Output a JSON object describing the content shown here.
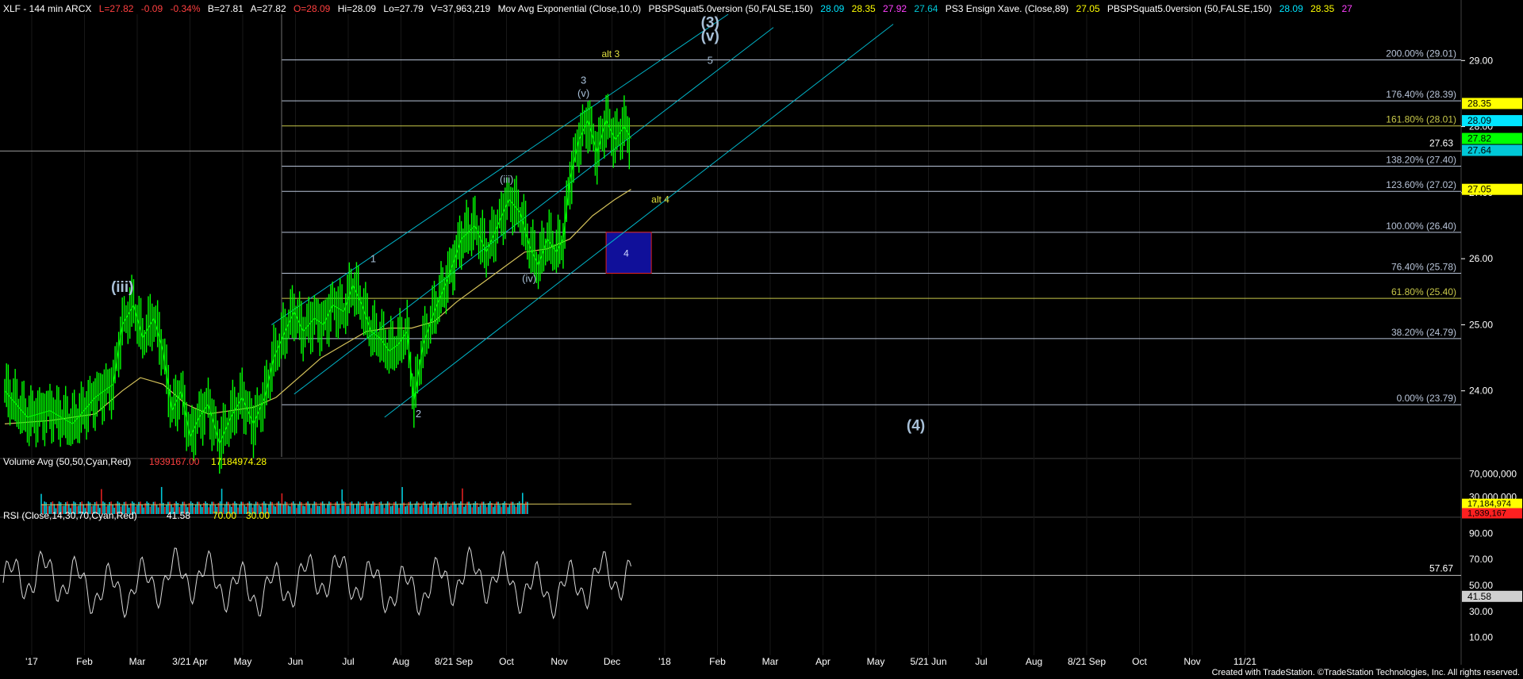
{
  "header": {
    "symbol": "XLF - 144 min ARCX",
    "last": "L=27.82",
    "chg": "-0.09",
    "pct": "-0.34%",
    "bid": "B=27.81",
    "ask": "A=27.82",
    "open": "O=28.09",
    "hi": "Hi=28.09",
    "lo": "Lo=27.79",
    "vol": "V=37,963,219",
    "ema_label": "Mov Avg Exponential (Close,10,0)",
    "ind1_label": "PBSPSquat5.0version (50,FALSE,150)",
    "ind1_vals": [
      "28.09",
      "28.35",
      "27.92",
      "27.64"
    ],
    "ind2_label": "PS3 Ensign Xave. (Close,89)",
    "ind2_val": "27.05",
    "ind3_label": "PBSPSquat5.0version (50,FALSE,150)",
    "ind3_vals": [
      "28.09",
      "28.35",
      "27"
    ]
  },
  "volume_panel": {
    "label": "Volume Avg (50,50,Cyan,Red)",
    "val1": "1939167.00",
    "val2": "17184974.28",
    "ticks": [
      "70,000,000",
      "30,000,000"
    ],
    "badge_avg": "17,184,974",
    "badge_last": "1,939,167"
  },
  "rsi_panel": {
    "label": "RSI (Close,14,30,70,Cyan,Red)",
    "val": "41.58",
    "ob": "70.00",
    "os": "30.00",
    "ticks": [
      "90.00",
      "70.00",
      "50.00",
      "30.00",
      "10.00"
    ],
    "level_label": "57.67",
    "badge": "41.58"
  },
  "footer": "Created with TradeStation. ©TradeStation Technologies, Inc. All rights reserved.",
  "colors": {
    "price": "#00ff00",
    "ema": "#d4c25a",
    "channel": "#00b4c8",
    "fib": "#b8c4d8",
    "fib_gold": "#c8c84a",
    "label_blue": "#a8c0d8",
    "label_gold": "#e0e040",
    "box": "#10109a"
  },
  "chart_data": {
    "type": "line",
    "title": "XLF - 144 min ARCX",
    "ylim": [
      23.0,
      29.7
    ],
    "y_ticks": [
      "29.00",
      "28.00",
      "27.00",
      "26.00",
      "25.00",
      "24.00"
    ],
    "x_labels": [
      "'17",
      "Feb",
      "Mar",
      "3/21 Apr",
      "May",
      "Jun",
      "Jul",
      "Aug",
      "8/21 Sep",
      "Oct",
      "Nov",
      "Dec",
      "'18",
      "Feb",
      "Mar",
      "Apr",
      "May",
      "5/21 Jun",
      "Jul",
      "Aug",
      "8/21 Sep",
      "Oct",
      "Nov",
      "11/21"
    ],
    "series": [
      {
        "values": [
          [
            0,
            24.0
          ],
          [
            10,
            23.6
          ],
          [
            20,
            23.7
          ],
          [
            30,
            23.5
          ],
          [
            40,
            23.9
          ],
          [
            48,
            24.1
          ],
          [
            52,
            25.0
          ],
          [
            57,
            25.3
          ],
          [
            61,
            24.8
          ],
          [
            66,
            25.1
          ],
          [
            70,
            24.6
          ],
          [
            74,
            23.7
          ],
          [
            78,
            24.0
          ],
          [
            82,
            23.3
          ],
          [
            86,
            23.6
          ],
          [
            90,
            23.8
          ],
          [
            95,
            23.2
          ],
          [
            100,
            23.6
          ],
          [
            105,
            23.9
          ],
          [
            110,
            23.5
          ],
          [
            115,
            23.9
          ],
          [
            119,
            24.5
          ],
          [
            124,
            24.9
          ],
          [
            128,
            25.2
          ],
          [
            132,
            24.9
          ],
          [
            137,
            25.1
          ],
          [
            141,
            25.0
          ],
          [
            145,
            25.3
          ],
          [
            150,
            25.2
          ],
          [
            154,
            25.6
          ],
          [
            158,
            25.3
          ],
          [
            162,
            24.9
          ],
          [
            166,
            24.8
          ],
          [
            170,
            24.6
          ],
          [
            174,
            24.7
          ],
          [
            178,
            24.9
          ],
          [
            181,
            23.85
          ],
          [
            185,
            24.7
          ],
          [
            190,
            25.2
          ],
          [
            196,
            25.7
          ],
          [
            202,
            26.3
          ],
          [
            208,
            26.5
          ],
          [
            213,
            26.1
          ],
          [
            218,
            26.5
          ],
          [
            223,
            26.9
          ],
          [
            228,
            26.7
          ],
          [
            232,
            26.2
          ],
          [
            236,
            25.9
          ],
          [
            240,
            26.3
          ],
          [
            244,
            26.1
          ],
          [
            247,
            26.3
          ],
          [
            250,
            27.2
          ],
          [
            254,
            27.8
          ],
          [
            258,
            28.1
          ],
          [
            262,
            27.6
          ],
          [
            266,
            28.1
          ],
          [
            270,
            27.8
          ],
          [
            274,
            28.0
          ],
          [
            277,
            27.82
          ]
        ]
      },
      {
        "name": "Mov Avg Exponential (Close,10,0)",
        "values": [
          [
            0,
            23.5
          ],
          [
            20,
            23.55
          ],
          [
            40,
            23.65
          ],
          [
            52,
            24.0
          ],
          [
            60,
            24.2
          ],
          [
            70,
            24.1
          ],
          [
            80,
            23.8
          ],
          [
            90,
            23.65
          ],
          [
            100,
            23.7
          ],
          [
            110,
            23.75
          ],
          [
            120,
            23.9
          ],
          [
            130,
            24.2
          ],
          [
            140,
            24.5
          ],
          [
            150,
            24.7
          ],
          [
            160,
            24.9
          ],
          [
            170,
            24.95
          ],
          [
            180,
            24.95
          ],
          [
            190,
            25.05
          ],
          [
            200,
            25.35
          ],
          [
            210,
            25.6
          ],
          [
            220,
            25.85
          ],
          [
            230,
            26.1
          ],
          [
            240,
            26.15
          ],
          [
            250,
            26.3
          ],
          [
            260,
            26.65
          ],
          [
            270,
            26.9
          ],
          [
            277,
            27.05
          ]
        ]
      }
    ],
    "fib_levels": [
      {
        "label": "200.00% (29.01)",
        "value": 29.01
      },
      {
        "label": "176.40% (28.39)",
        "value": 28.39
      },
      {
        "label": "161.80% (28.01)",
        "value": 28.01
      },
      {
        "label": "138.20% (27.40)",
        "value": 27.4
      },
      {
        "label": "123.60% (27.02)",
        "value": 27.02
      },
      {
        "label": "100.00% (26.40)",
        "value": 26.4
      },
      {
        "label": "76.40% (25.78)",
        "value": 25.78
      },
      {
        "label": "61.80% (25.40)",
        "value": 25.4
      },
      {
        "label": "38.20% (24.79)",
        "value": 24.79
      },
      {
        "label": "0.00% (23.79)",
        "value": 23.79
      }
    ],
    "price_badges": [
      {
        "label": "28.35",
        "value": 28.35,
        "color": "#ffff00"
      },
      {
        "label": "28.09",
        "value": 28.09,
        "color": "#00e5ff"
      },
      {
        "label": "27.82",
        "value": 27.82,
        "color": "#00ff00"
      },
      {
        "label": "27.64",
        "value": 27.64,
        "color": "#00c8d8"
      },
      {
        "label": "27.05",
        "value": 27.05,
        "color": "#ffff00"
      }
    ],
    "horizontal_label": {
      "label": "27.63",
      "value": 27.63
    },
    "wave_labels": [
      {
        "text": "(iii)",
        "x": 52,
        "y": 25.5,
        "size": "large"
      },
      {
        "text": "1",
        "x": 163,
        "y": 25.95,
        "size": "small"
      },
      {
        "text": "2",
        "x": 183,
        "y": 23.6,
        "size": "small"
      },
      {
        "text": "(iii)",
        "x": 222,
        "y": 27.15,
        "size": "small"
      },
      {
        "text": "(iv)",
        "x": 232,
        "y": 25.65,
        "size": "small"
      },
      {
        "text": "(v)",
        "x": 256,
        "y": 28.45,
        "size": "small"
      },
      {
        "text": "3",
        "x": 256,
        "y": 28.65,
        "size": "small"
      },
      {
        "text": "alt 3",
        "x": 268,
        "y": 29.05,
        "size": "gold"
      },
      {
        "text": "alt 4",
        "x": 290,
        "y": 26.85,
        "size": "gold"
      },
      {
        "text": "5",
        "x": 312,
        "y": 28.95,
        "size": "small"
      },
      {
        "text": "(3)",
        "x": 312,
        "y": 29.5,
        "size": "large"
      },
      {
        "text": "(v)",
        "x": 312,
        "y": 29.3,
        "size": "large"
      },
      {
        "text": "(4)",
        "x": 403,
        "y": 23.4,
        "size": "large"
      }
    ],
    "target_box": {
      "label": "4",
      "x0": 266,
      "x1": 286,
      "y0": 25.78,
      "y1": 26.4
    },
    "channel_lines": [
      [
        [
          118,
          25.0
        ],
        [
          320,
          29.7
        ]
      ],
      [
        [
          128,
          23.95
        ],
        [
          340,
          29.5
        ]
      ],
      [
        [
          168,
          23.6
        ],
        [
          393,
          29.55
        ]
      ]
    ]
  }
}
